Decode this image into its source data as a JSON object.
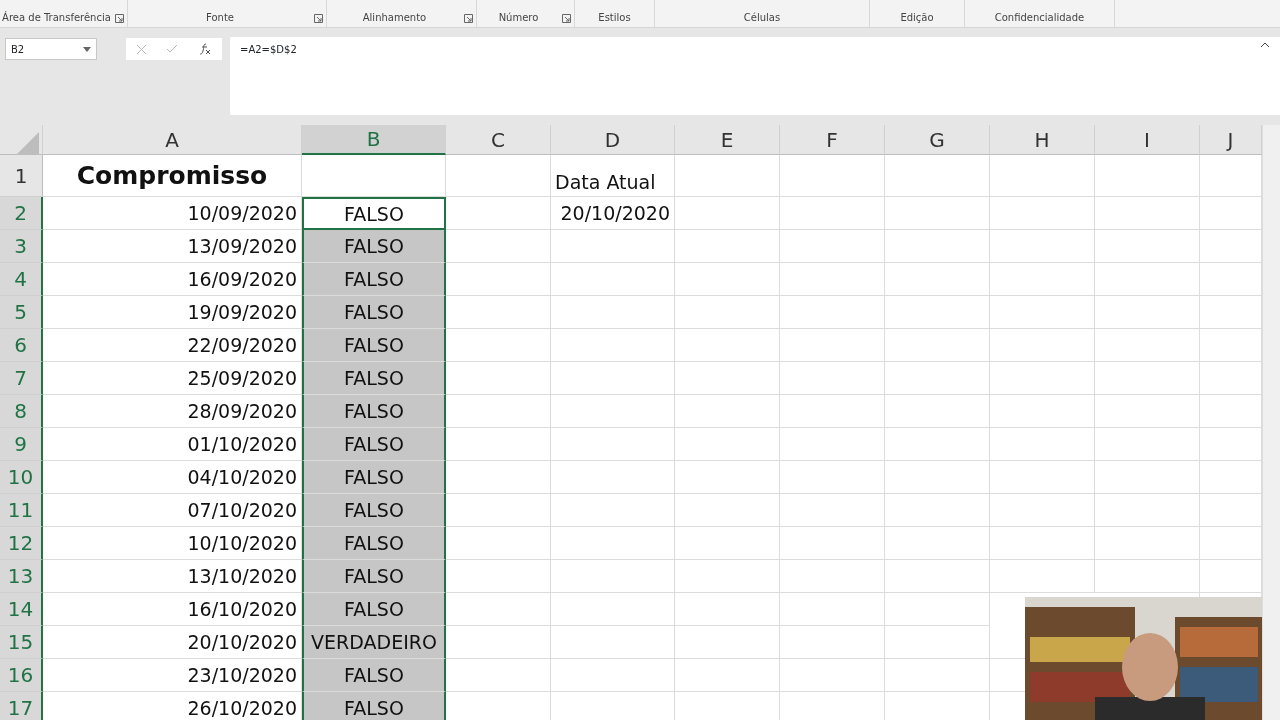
{
  "ribbon_groups": [
    {
      "label": "Área de Transferência",
      "launcher": true
    },
    {
      "label": "Fonte",
      "launcher": true
    },
    {
      "label": "Alinhamento",
      "launcher": true
    },
    {
      "label": "Número",
      "launcher": true
    },
    {
      "label": "Estilos",
      "launcher": false
    },
    {
      "label": "Células",
      "launcher": false
    },
    {
      "label": "Edição",
      "launcher": false
    },
    {
      "label": "Confidencialidade",
      "launcher": false
    }
  ],
  "name_box": "B2",
  "formula": "=A2=$D$2",
  "columns": [
    {
      "label": "A",
      "selected": false
    },
    {
      "label": "B",
      "selected": true
    },
    {
      "label": "C",
      "selected": false
    },
    {
      "label": "D",
      "selected": false
    },
    {
      "label": "E",
      "selected": false
    },
    {
      "label": "F",
      "selected": false
    },
    {
      "label": "G",
      "selected": false
    },
    {
      "label": "H",
      "selected": false
    },
    {
      "label": "I",
      "selected": false
    },
    {
      "label": "J",
      "selected": false
    }
  ],
  "rows": [
    {
      "number": "1",
      "selected": false,
      "active": false,
      "a": "Compromisso",
      "d": "Data Atual"
    },
    {
      "number": "2",
      "selected": true,
      "active": true,
      "a": "10/09/2020",
      "b": "FALSO",
      "d": "20/10/2020"
    },
    {
      "number": "3",
      "selected": true,
      "active": false,
      "a": "13/09/2020",
      "b": "FALSO"
    },
    {
      "number": "4",
      "selected": true,
      "active": false,
      "a": "16/09/2020",
      "b": "FALSO"
    },
    {
      "number": "5",
      "selected": true,
      "active": false,
      "a": "19/09/2020",
      "b": "FALSO"
    },
    {
      "number": "6",
      "selected": true,
      "active": false,
      "a": "22/09/2020",
      "b": "FALSO"
    },
    {
      "number": "7",
      "selected": true,
      "active": false,
      "a": "25/09/2020",
      "b": "FALSO"
    },
    {
      "number": "8",
      "selected": true,
      "active": false,
      "a": "28/09/2020",
      "b": "FALSO"
    },
    {
      "number": "9",
      "selected": true,
      "active": false,
      "a": "01/10/2020",
      "b": "FALSO"
    },
    {
      "number": "10",
      "selected": true,
      "active": false,
      "a": "04/10/2020",
      "b": "FALSO"
    },
    {
      "number": "11",
      "selected": true,
      "active": false,
      "a": "07/10/2020",
      "b": "FALSO"
    },
    {
      "number": "12",
      "selected": true,
      "active": false,
      "a": "10/10/2020",
      "b": "FALSO"
    },
    {
      "number": "13",
      "selected": true,
      "active": false,
      "a": "13/10/2020",
      "b": "FALSO"
    },
    {
      "number": "14",
      "selected": true,
      "active": false,
      "a": "16/10/2020",
      "b": "FALSO"
    },
    {
      "number": "15",
      "selected": true,
      "active": false,
      "a": "20/10/2020",
      "b": "VERDADEIRO"
    },
    {
      "number": "16",
      "selected": true,
      "active": false,
      "a": "23/10/2020",
      "b": "FALSO"
    },
    {
      "number": "17",
      "selected": true,
      "active": false,
      "a": "26/10/2020",
      "b": "FALSO"
    }
  ]
}
